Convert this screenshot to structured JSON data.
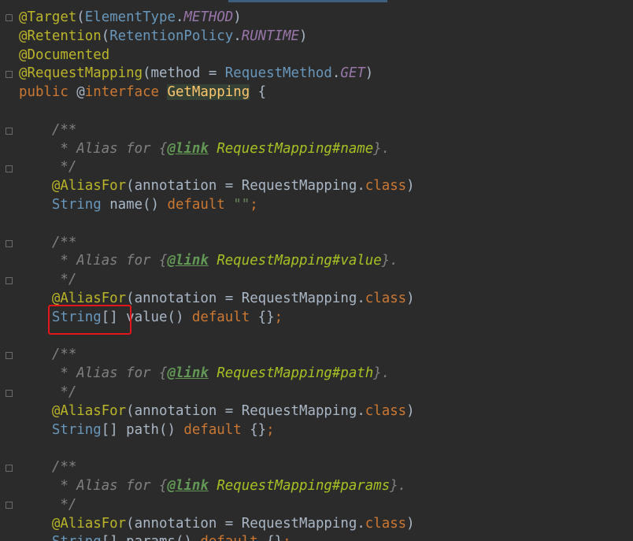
{
  "editor": {
    "lines": [
      {
        "segments": [
          {
            "text": "@Target",
            "cls": "ann"
          },
          {
            "text": "(",
            "cls": "punc"
          },
          {
            "text": "ElementType",
            "cls": "type"
          },
          {
            "text": ".",
            "cls": "punc"
          },
          {
            "text": "METHOD",
            "cls": "field"
          },
          {
            "text": ")",
            "cls": "punc"
          }
        ]
      },
      {
        "segments": [
          {
            "text": "@Retention",
            "cls": "ann"
          },
          {
            "text": "(",
            "cls": "punc"
          },
          {
            "text": "RetentionPolicy",
            "cls": "type"
          },
          {
            "text": ".",
            "cls": "punc"
          },
          {
            "text": "RUNTIME",
            "cls": "field"
          },
          {
            "text": ")",
            "cls": "punc"
          }
        ]
      },
      {
        "segments": [
          {
            "text": "@Documented",
            "cls": "ann"
          }
        ]
      },
      {
        "segments": [
          {
            "text": "@RequestMapping",
            "cls": "ann"
          },
          {
            "text": "(method = ",
            "cls": "punc"
          },
          {
            "text": "RequestMethod",
            "cls": "type"
          },
          {
            "text": ".",
            "cls": "punc"
          },
          {
            "text": "GET",
            "cls": "field"
          },
          {
            "text": ")",
            "cls": "punc"
          }
        ]
      },
      {
        "segments": [
          {
            "text": "public ",
            "cls": "kw"
          },
          {
            "text": "@",
            "cls": "punc"
          },
          {
            "text": "interface ",
            "cls": "kw"
          },
          {
            "text": "GetMapping",
            "cls": "ifacename"
          },
          {
            "text": " {",
            "cls": "punc"
          }
        ]
      },
      {
        "segments": []
      },
      {
        "segments": [
          {
            "text": "    /**",
            "cls": "cmt-dim"
          }
        ]
      },
      {
        "segments": [
          {
            "text": "     * Alias for {",
            "cls": "cmt-dim"
          },
          {
            "text": "@link",
            "cls": "tag"
          },
          {
            "text": " ",
            "cls": "cmt-dim"
          },
          {
            "text": "RequestMapping#name",
            "cls": "refcls"
          },
          {
            "text": "}.",
            "cls": "cmt-dim"
          }
        ]
      },
      {
        "segments": [
          {
            "text": "     */",
            "cls": "cmt-dim"
          }
        ]
      },
      {
        "segments": [
          {
            "text": "    @AliasFor",
            "cls": "ann"
          },
          {
            "text": "(annotation = ",
            "cls": "punc"
          },
          {
            "text": "RequestMapping",
            "cls": "cls"
          },
          {
            "text": ".",
            "cls": "punc"
          },
          {
            "text": "class",
            "cls": "kw"
          },
          {
            "text": ")",
            "cls": "punc"
          }
        ]
      },
      {
        "segments": [
          {
            "text": "    ",
            "cls": "punc"
          },
          {
            "text": "String",
            "cls": "type"
          },
          {
            "text": " name() ",
            "cls": "punc"
          },
          {
            "text": "default ",
            "cls": "kw"
          },
          {
            "text": "\"\"",
            "cls": "str"
          },
          {
            "text": ";",
            "cls": "kw"
          }
        ]
      },
      {
        "segments": []
      },
      {
        "segments": [
          {
            "text": "    /**",
            "cls": "cmt-dim"
          }
        ]
      },
      {
        "segments": [
          {
            "text": "     * Alias for {",
            "cls": "cmt-dim"
          },
          {
            "text": "@link",
            "cls": "tag"
          },
          {
            "text": " ",
            "cls": "cmt-dim"
          },
          {
            "text": "RequestMapping#value",
            "cls": "refcls"
          },
          {
            "text": "}.",
            "cls": "cmt-dim"
          }
        ]
      },
      {
        "segments": [
          {
            "text": "     */",
            "cls": "cmt-dim"
          }
        ]
      },
      {
        "segments": [
          {
            "text": "    @AliasFor",
            "cls": "ann"
          },
          {
            "text": "(annotation = ",
            "cls": "punc"
          },
          {
            "text": "RequestMapping",
            "cls": "cls"
          },
          {
            "text": ".",
            "cls": "punc"
          },
          {
            "text": "class",
            "cls": "kw"
          },
          {
            "text": ")",
            "cls": "punc"
          }
        ]
      },
      {
        "segments": [
          {
            "text": "    ",
            "cls": "punc"
          },
          {
            "text": "String",
            "cls": "type"
          },
          {
            "text": "[] value() ",
            "cls": "punc"
          },
          {
            "text": "default ",
            "cls": "kw"
          },
          {
            "text": "{}",
            "cls": "punc"
          },
          {
            "text": ";",
            "cls": "kw"
          }
        ]
      },
      {
        "segments": []
      },
      {
        "segments": [
          {
            "text": "    /**",
            "cls": "cmt-dim"
          }
        ]
      },
      {
        "segments": [
          {
            "text": "     * Alias for {",
            "cls": "cmt-dim"
          },
          {
            "text": "@link",
            "cls": "tag"
          },
          {
            "text": " ",
            "cls": "cmt-dim"
          },
          {
            "text": "RequestMapping#path",
            "cls": "refcls"
          },
          {
            "text": "}.",
            "cls": "cmt-dim"
          }
        ]
      },
      {
        "segments": [
          {
            "text": "     */",
            "cls": "cmt-dim"
          }
        ]
      },
      {
        "segments": [
          {
            "text": "    @AliasFor",
            "cls": "ann"
          },
          {
            "text": "(annotation = ",
            "cls": "punc"
          },
          {
            "text": "RequestMapping",
            "cls": "cls"
          },
          {
            "text": ".",
            "cls": "punc"
          },
          {
            "text": "class",
            "cls": "kw"
          },
          {
            "text": ")",
            "cls": "punc"
          }
        ]
      },
      {
        "segments": [
          {
            "text": "    ",
            "cls": "punc"
          },
          {
            "text": "String",
            "cls": "type"
          },
          {
            "text": "[] path() ",
            "cls": "punc"
          },
          {
            "text": "default ",
            "cls": "kw"
          },
          {
            "text": "{}",
            "cls": "punc"
          },
          {
            "text": ";",
            "cls": "kw"
          }
        ]
      },
      {
        "segments": []
      },
      {
        "segments": [
          {
            "text": "    /**",
            "cls": "cmt-dim"
          }
        ]
      },
      {
        "segments": [
          {
            "text": "     * Alias for {",
            "cls": "cmt-dim"
          },
          {
            "text": "@link",
            "cls": "tag"
          },
          {
            "text": " ",
            "cls": "cmt-dim"
          },
          {
            "text": "RequestMapping#params",
            "cls": "refcls"
          },
          {
            "text": "}.",
            "cls": "cmt-dim"
          }
        ]
      },
      {
        "segments": [
          {
            "text": "     */",
            "cls": "cmt-dim"
          }
        ]
      },
      {
        "segments": [
          {
            "text": "    @AliasFor",
            "cls": "ann"
          },
          {
            "text": "(annotation = ",
            "cls": "punc"
          },
          {
            "text": "RequestMapping",
            "cls": "cls"
          },
          {
            "text": ".",
            "cls": "punc"
          },
          {
            "text": "class",
            "cls": "kw"
          },
          {
            "text": ")",
            "cls": "punc"
          }
        ]
      },
      {
        "segments": [
          {
            "text": "    ",
            "cls": "punc"
          },
          {
            "text": "String",
            "cls": "type"
          },
          {
            "text": "[] params() ",
            "cls": "punc"
          },
          {
            "text": "default ",
            "cls": "kw"
          },
          {
            "text": "{}",
            "cls": "punc"
          },
          {
            "text": ";",
            "cls": "kw"
          }
        ]
      }
    ]
  },
  "colors": {
    "background": "#2b2b2b",
    "highlight_box": "#e3171b"
  }
}
